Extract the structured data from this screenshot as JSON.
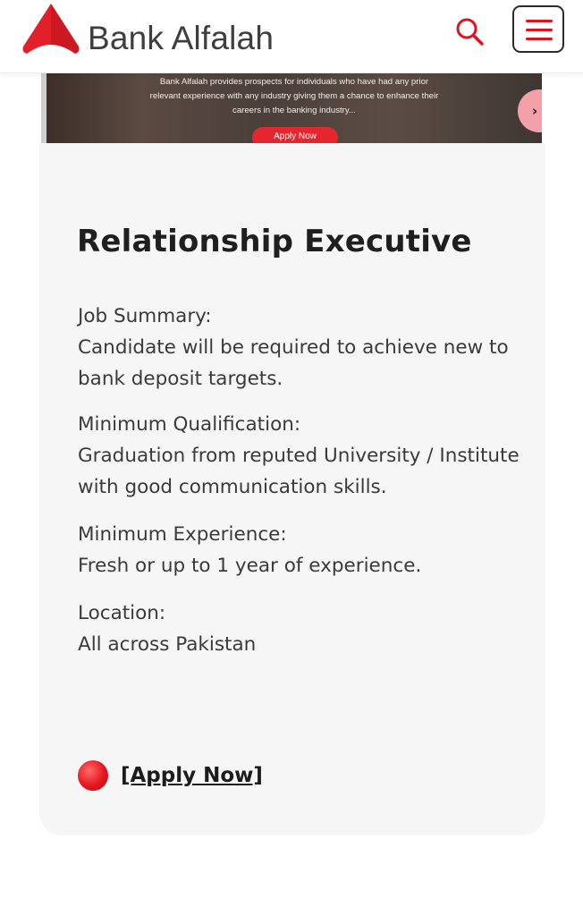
{
  "header": {
    "brand_name": "Bank Alfalah",
    "search_icon": "search-icon",
    "menu_icon": "hamburger-menu-icon",
    "brand_color": "#d7161f"
  },
  "banner": {
    "text": "Bank Alfalah provides prospects for individuals who have had any prior relevant experience with any industry giving them a chance to enhance their careers in the banking industry...",
    "apply_label": "Apply Now",
    "arrow_icon": "chevron-right-icon"
  },
  "job": {
    "title": "Relationship Executive",
    "sections": [
      {
        "label": "Job Summary:",
        "value": "Candidate will be required to achieve new to bank deposit targets."
      },
      {
        "label": "Minimum Qualification:",
        "value": "Graduation from reputed University / Institute with good communication skills."
      },
      {
        "label": "Minimum Experience:",
        "value": "Fresh or up to 1 year of experience."
      },
      {
        "label": "Location:",
        "value": "All across Pakistan"
      }
    ],
    "apply_link_label": "[Apply Now]",
    "apply_icon": "red-circle-icon"
  }
}
